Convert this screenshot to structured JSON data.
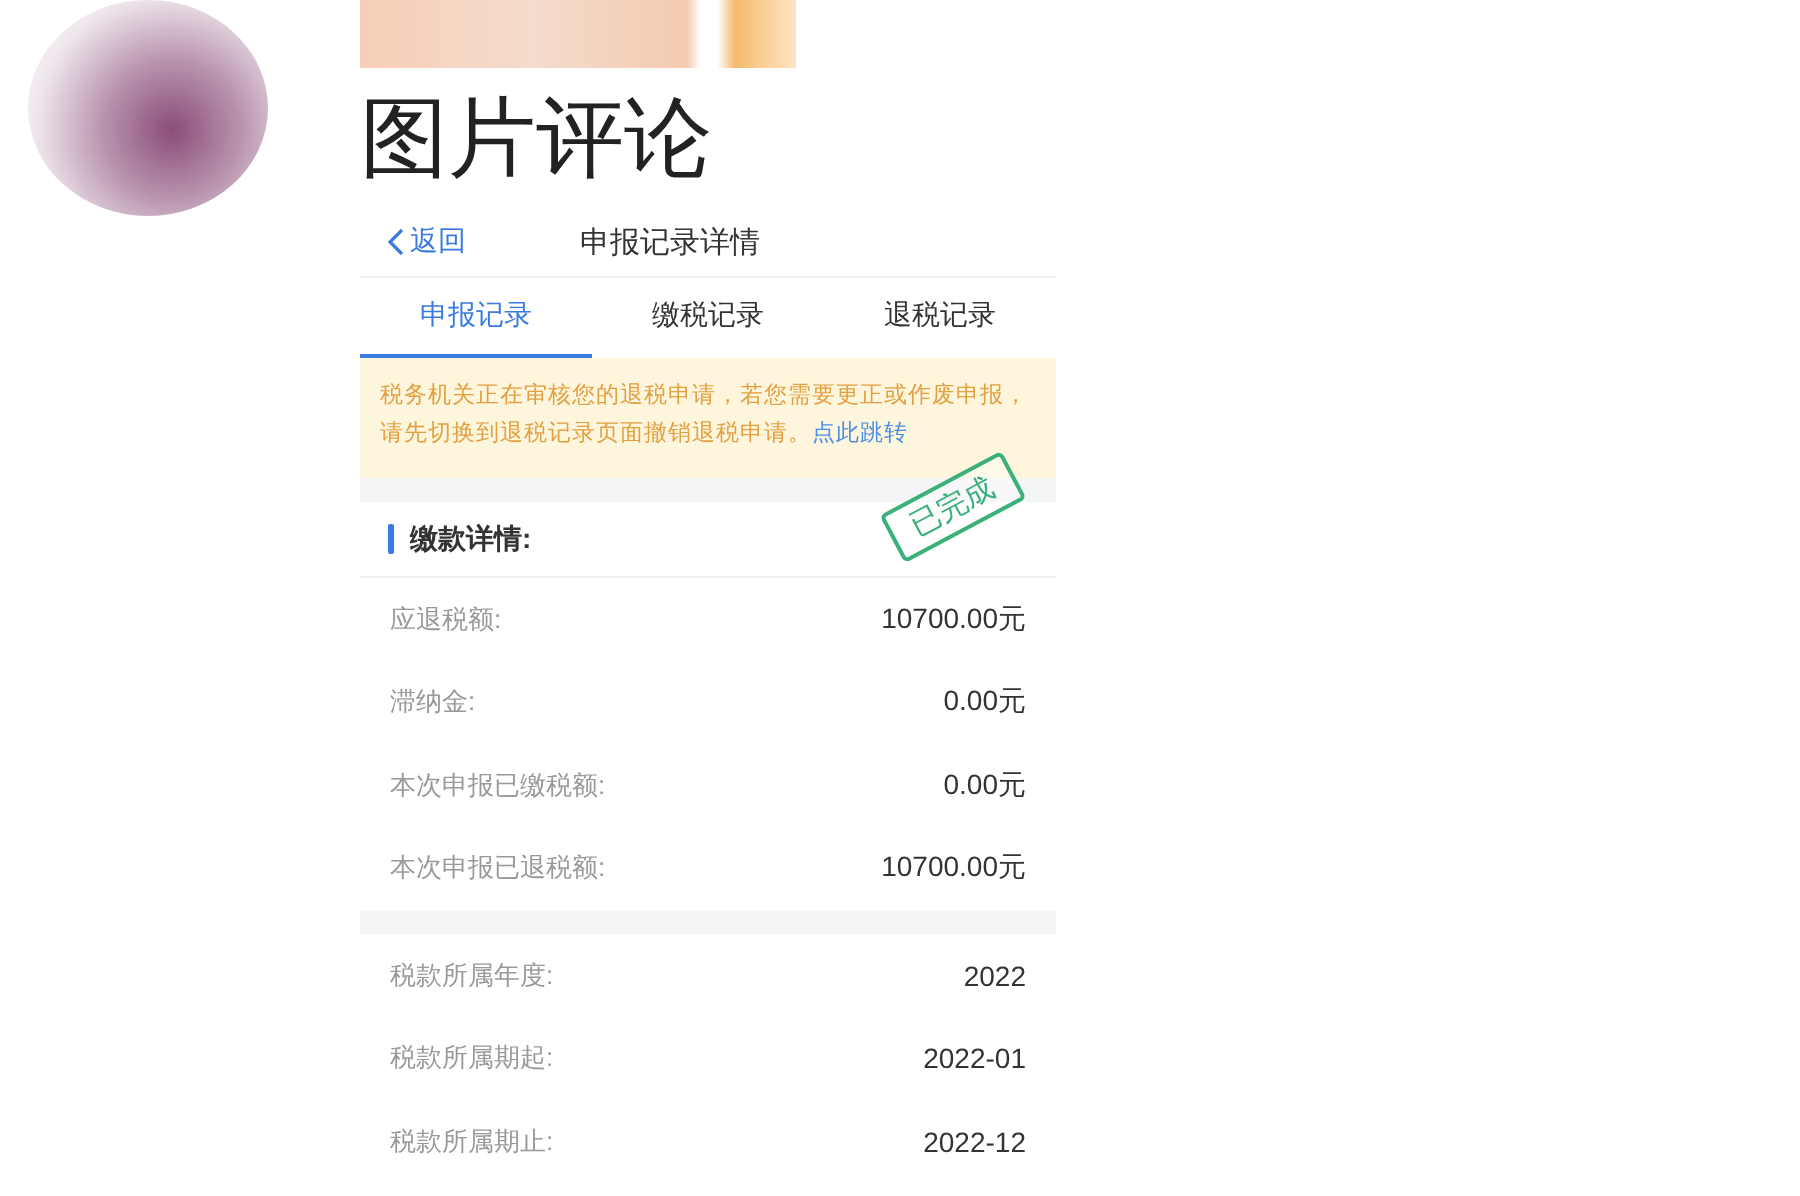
{
  "post": {
    "title": "图片评论"
  },
  "screenshot": {
    "nav": {
      "back": "返回",
      "title": "申报记录详情"
    },
    "tabs": [
      {
        "label": "申报记录",
        "selected": true
      },
      {
        "label": "缴税记录",
        "selected": false
      },
      {
        "label": "退税记录",
        "selected": false
      }
    ],
    "notice": {
      "text": "税务机关正在审核您的退税申请，若您需要更正或作废申报，请先切换到退税记录页面撤销退税申请。",
      "link": "点此跳转"
    },
    "stamp": "已完成",
    "sections": [
      {
        "heading": "缴款详情:",
        "rows": [
          {
            "label": "应退税额:",
            "value": "10700.00元"
          },
          {
            "label": "滞纳金:",
            "value": "0.00元"
          },
          {
            "label": "本次申报已缴税额:",
            "value": "0.00元"
          },
          {
            "label": "本次申报已退税额:",
            "value": "10700.00元"
          }
        ]
      },
      {
        "rows": [
          {
            "label": "税款所属年度:",
            "value": "2022"
          },
          {
            "label": "税款所属期起:",
            "value": "2022-01"
          },
          {
            "label": "税款所属期止:",
            "value": "2022-12"
          }
        ]
      }
    ]
  }
}
